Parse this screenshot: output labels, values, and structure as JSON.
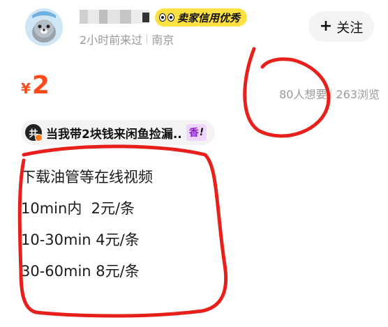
{
  "seller": {
    "badge_label": "卖家信用优秀",
    "last_seen": "2小时前来过",
    "location": "南京"
  },
  "follow_button": {
    "label": "关注"
  },
  "listing": {
    "currency_symbol": "¥",
    "price": "2",
    "wants": "80人想要",
    "views": "263浏览"
  },
  "promo": {
    "icon_text": "共",
    "text": "当我带2块钱来闲鱼捡漏..",
    "tag": "香",
    "tag_mark": "!"
  },
  "description": {
    "lines": [
      "下载油管等在线视频",
      "10min内  2元/条",
      "10-30min 4元/条",
      "30-60min 8元/条"
    ]
  },
  "colors": {
    "price": "#ff4a1c",
    "badge_bg": "#ffe141",
    "annotation": "#e8201b"
  }
}
